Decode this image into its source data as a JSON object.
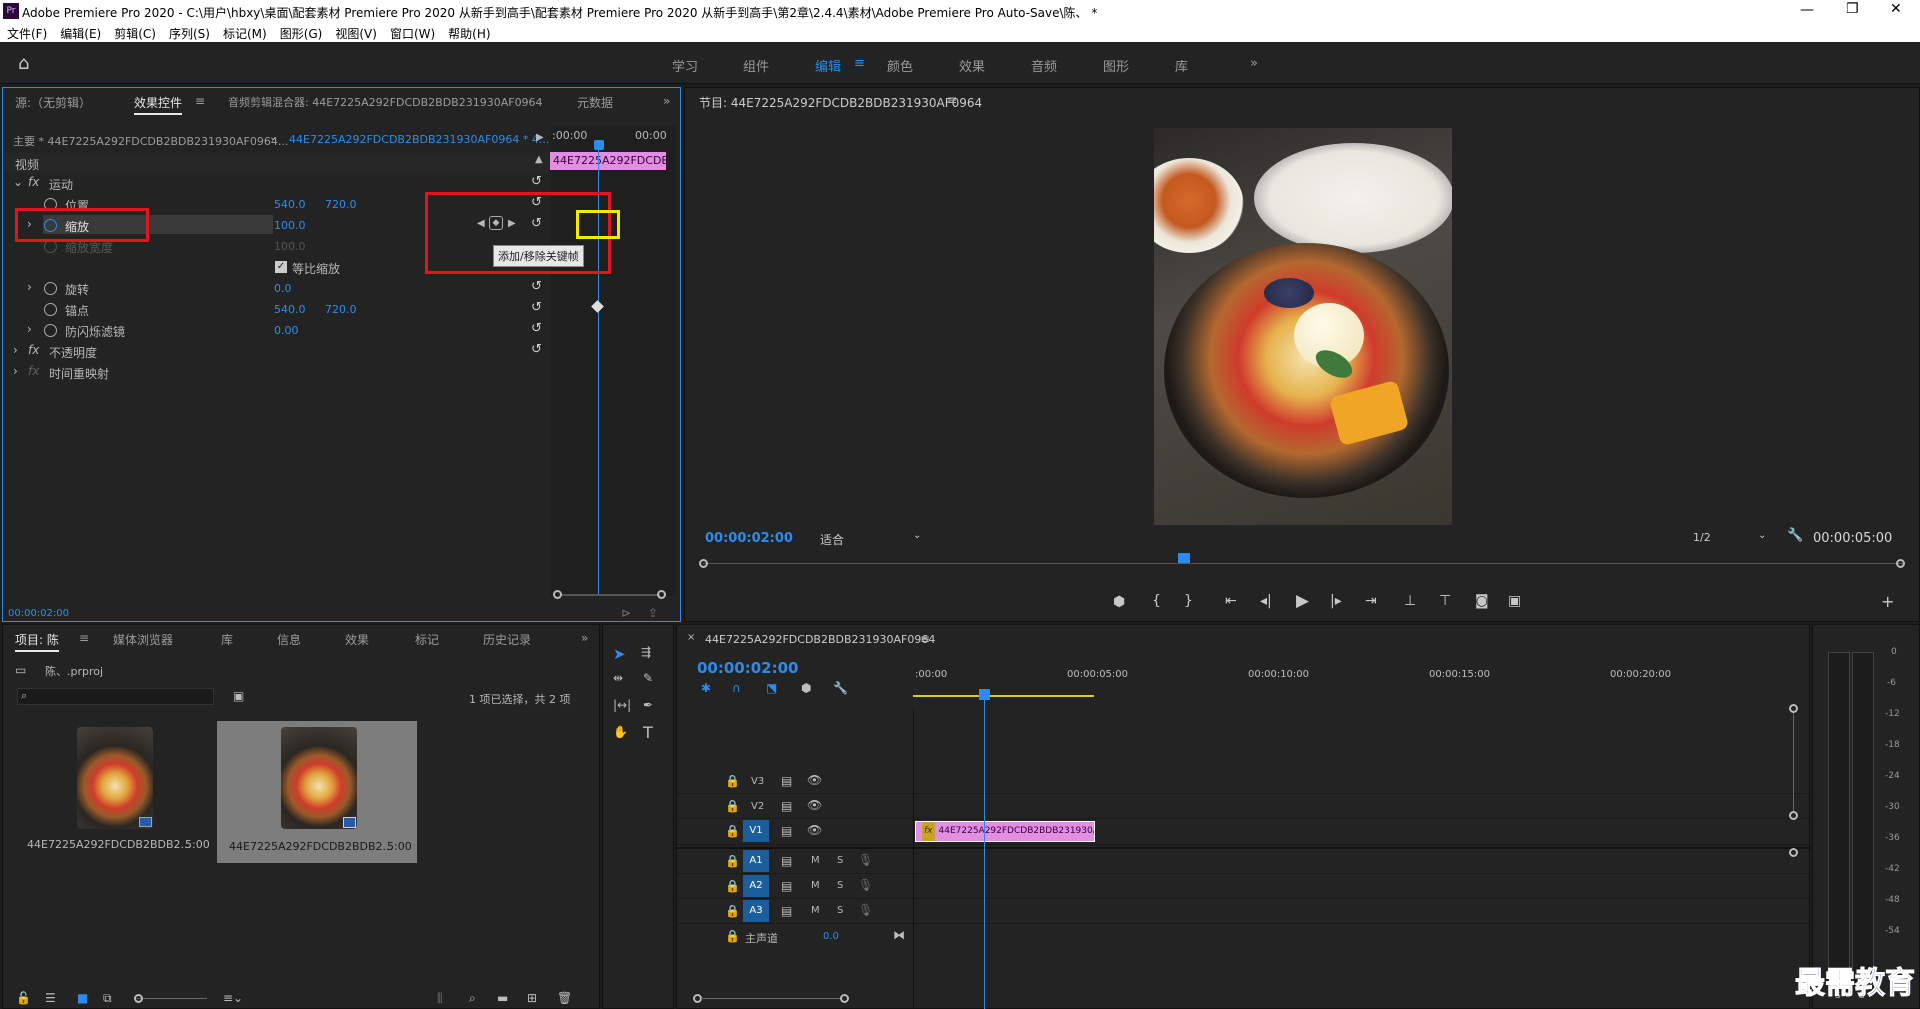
{
  "titlebar": {
    "app_icon": "Pr",
    "title": "Adobe Premiere Pro 2020 - C:\\用户\\hbxy\\桌面\\配套素材 Premiere Pro 2020 从新手到高手\\配套素材 Premiere Pro 2020 从新手到高手\\第2章\\2.4.4\\素材\\Adobe Premiere Pro Auto-Save\\陈、 *"
  },
  "menu": [
    "文件(F)",
    "编辑(E)",
    "剪辑(C)",
    "序列(S)",
    "标记(M)",
    "图形(G)",
    "视图(V)",
    "窗口(W)",
    "帮助(H)"
  ],
  "workspaces": [
    "学习",
    "组件",
    "编辑",
    "颜色",
    "效果",
    "音频",
    "图形",
    "库"
  ],
  "active_workspace": "编辑",
  "effect_panel": {
    "tabs": [
      "源:（无剪辑）",
      "效果控件",
      "音频剪辑混合器: 44E7225A292FDCDB2BDB231930AF0964",
      "元数据"
    ],
    "master": "主要 * 44E7225A292FDCDB2BDB231930AF0964...",
    "sequence": "44E7225A292FDCDB2BDB231930AF0964 * 4...",
    "mini_start": ":00:00",
    "mini_end": "00:00",
    "clip_label": "44E7225A292FDCDB2",
    "section_video": "视频",
    "motion": "运动",
    "position": "位置",
    "position_x": "540.0",
    "position_y": "720.0",
    "scale": "缩放",
    "scale_val": "100.0",
    "scale_width": "缩放宽度",
    "scale_width_val": "100.0",
    "uniform": "等比缩放",
    "rotation": "旋转",
    "rotation_val": "0.0",
    "anchor": "锚点",
    "anchor_x": "540.0",
    "anchor_y": "720.0",
    "flicker": "防闪烁滤镜",
    "flicker_val": "0.00",
    "opacity": "不透明度",
    "time_remap": "时间重映射",
    "tooltip": "添加/移除关键帧",
    "timecode": "00:00:02:00"
  },
  "program": {
    "title": "节目: 44E7225A292FDCDB2BDB231930AF0964",
    "timecode": "00:00:02:00",
    "fit": "适合",
    "quality": "1/2",
    "duration": "00:00:05:00"
  },
  "project": {
    "tabs": [
      "项目: 陈",
      "媒体浏览器",
      "库",
      "信息",
      "效果",
      "标记",
      "历史记录"
    ],
    "file": "陈、.prproj",
    "selection": "1 项已选择，共 2 项",
    "items": [
      {
        "name": "44E7225A292FDCDB2BDB2...",
        "duration": "5:00"
      },
      {
        "name": "44E7225A292FDCDB2BDB2...",
        "duration": "5:00"
      }
    ]
  },
  "timeline": {
    "title": "44E7225A292FDCDB2BDB231930AF0964",
    "timecode": "00:00:02:00",
    "ruler": [
      ":00:00",
      "00:00:05:00",
      "00:00:10:00",
      "00:00:15:00",
      "00:00:20:00"
    ],
    "video_tracks": [
      "V3",
      "V2",
      "V1"
    ],
    "audio_tracks": [
      "A1",
      "A2",
      "A3"
    ],
    "master": "主声道",
    "master_val": "0.0",
    "clip": "44E7225A292FDCDB2BDB231930A",
    "clip_fx": "fx",
    "m": "M",
    "s": "S"
  },
  "meter": {
    "scale": [
      "0",
      "-6",
      "-12",
      "-18",
      "-24",
      "-30",
      "-36",
      "-42",
      "-48",
      "-54"
    ],
    "s1": "S",
    "s2": "S"
  },
  "watermark": "最需教育",
  "colors": {
    "accent": "#2d8ceb",
    "clip": "#e28ee2",
    "highlight_red": "#e0161e",
    "highlight_yellow": "#f4ea00"
  }
}
